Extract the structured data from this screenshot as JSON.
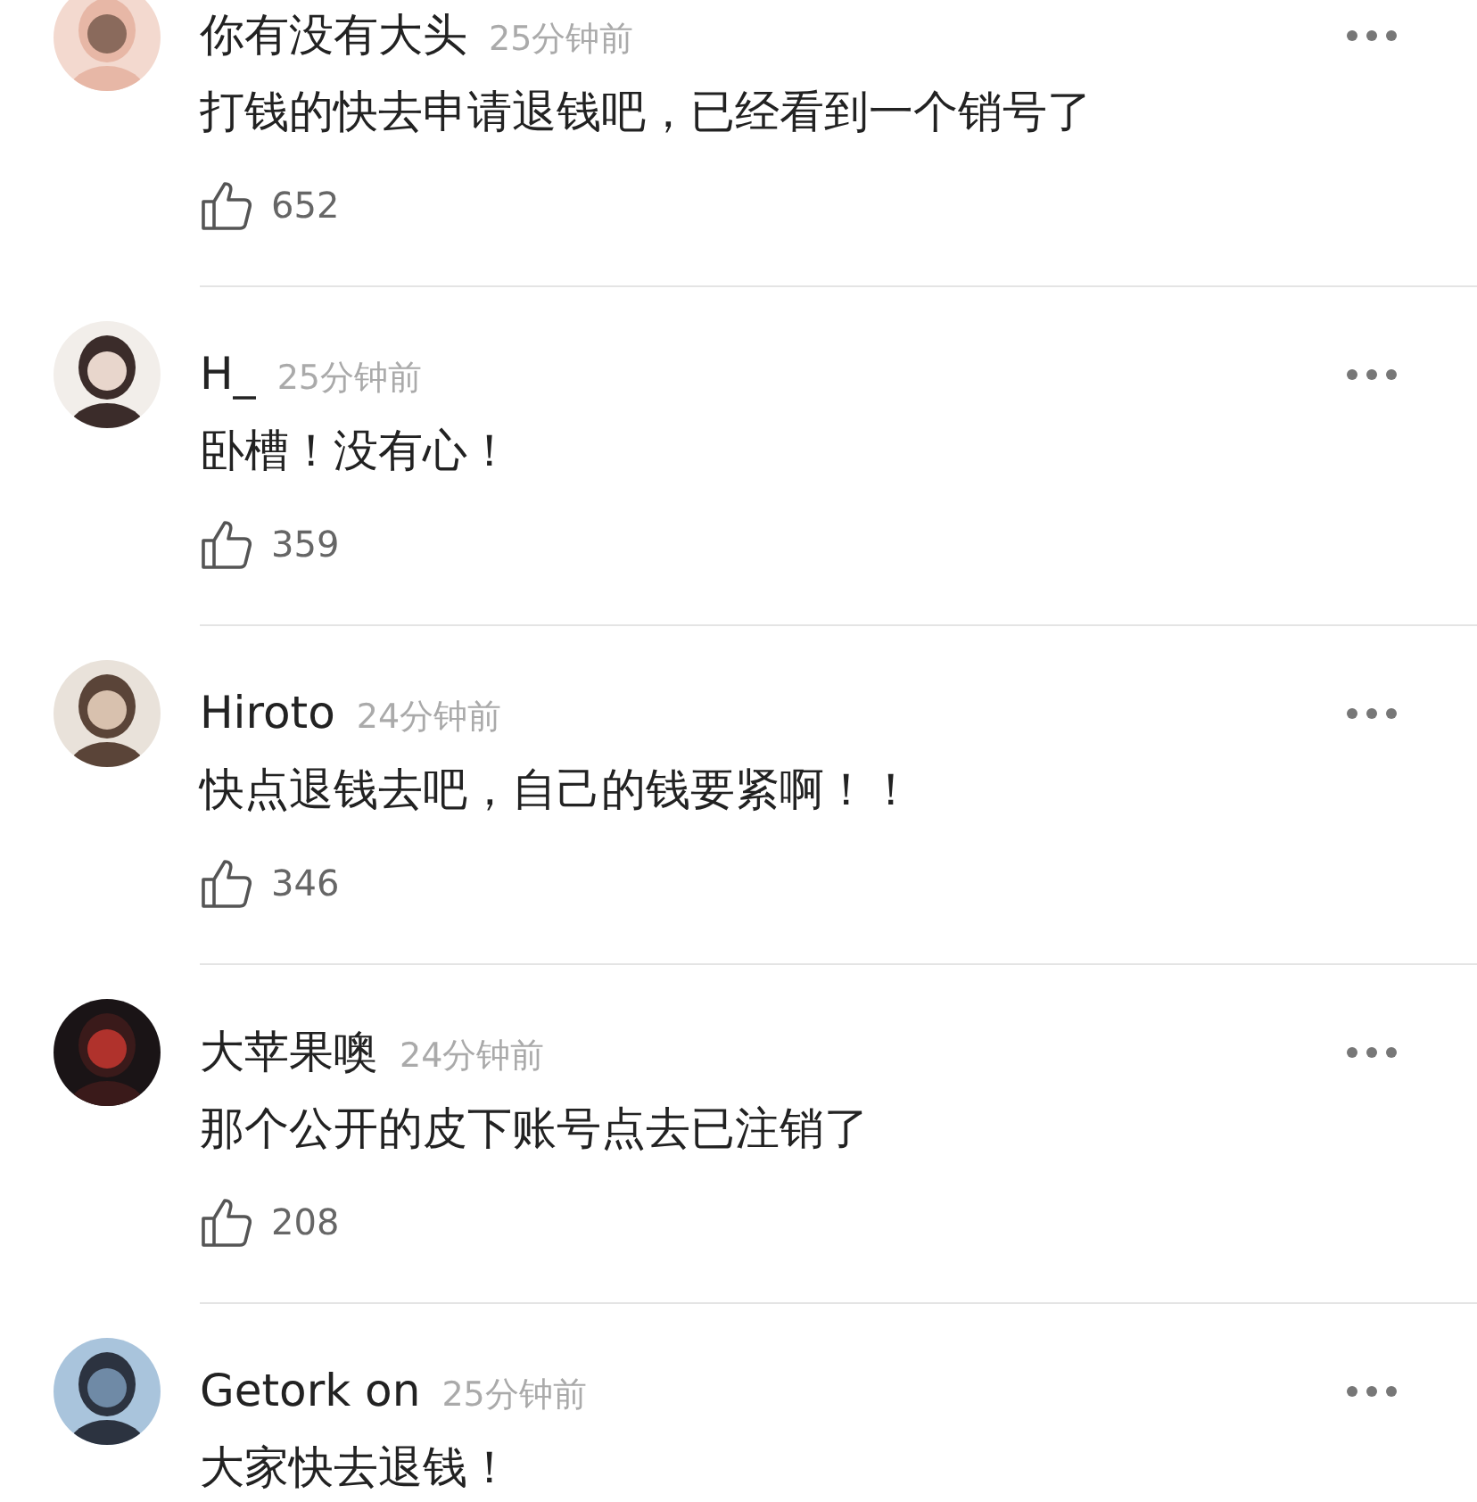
{
  "comments": [
    {
      "user": "你有没有大头",
      "time": "25分钟前",
      "text": "打钱的快去申请退钱吧，已经看到一个销号了",
      "likes": "652"
    },
    {
      "user": "H_",
      "time": "25分钟前",
      "text": "卧槽！没有心！",
      "likes": "359"
    },
    {
      "user": "Hiroto",
      "time": "24分钟前",
      "text": "快点退钱去吧，自己的钱要紧啊！！",
      "likes": "346"
    },
    {
      "user": "大苹果噢",
      "time": "24分钟前",
      "text": "那个公开的皮下账号点去已注销了",
      "likes": "208"
    },
    {
      "user": "Getork on",
      "time": "25分钟前",
      "text": "大家快去退钱！"
    }
  ]
}
